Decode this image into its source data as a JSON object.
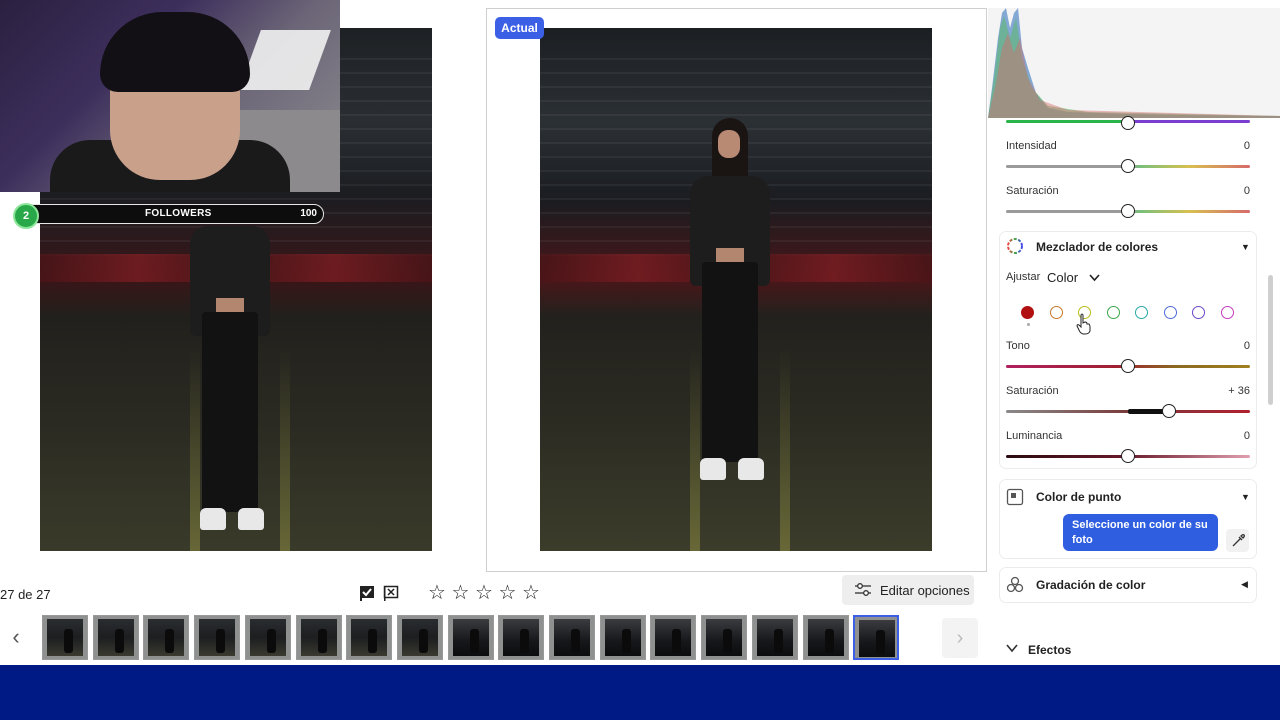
{
  "compare": {
    "badge": "Actual"
  },
  "webcam": {
    "followers_number": "2",
    "followers_label": "FOLLOWERS",
    "followers_count": "100"
  },
  "toolbar": {
    "counter": "27 de 27",
    "rating_stars": 5,
    "edit_options_label": "Editar opciones"
  },
  "filmstrip": {
    "thumb_count": 17,
    "selected_index": 16
  },
  "panel": {
    "top_sliders": [
      {
        "label": "Intensidad",
        "value": "0"
      },
      {
        "label": "Saturación",
        "value": "0"
      }
    ],
    "mixer": {
      "title": "Mezclador de colores",
      "adjust_label": "Ajustar",
      "adjust_value": "Color",
      "colors": [
        "#b01010",
        "#c7772b",
        "#b7bb16",
        "#3aa84a",
        "#29a9a4",
        "#4f6ad8",
        "#6a49c9",
        "#c33bbf"
      ],
      "sliders": [
        {
          "label": "Tono",
          "value": "0"
        },
        {
          "label": "Saturación",
          "value": "+ 36"
        },
        {
          "label": "Luminancia",
          "value": "0"
        }
      ]
    },
    "point_color": {
      "title": "Color de punto",
      "tooltip": "Seleccione un color de su foto"
    },
    "grading": {
      "title": "Gradación de color"
    },
    "effects": {
      "title": "Efectos"
    }
  },
  "colors": {
    "accent": "#3b5fe5",
    "bottom_bar": "#001a85"
  }
}
